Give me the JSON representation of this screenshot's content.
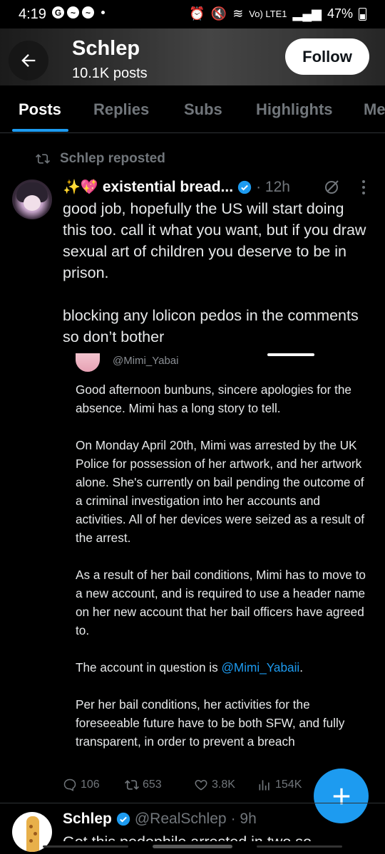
{
  "status_bar": {
    "time": "4:19",
    "left_icons": [
      "google-icon",
      "messenger-icon",
      "messenger-icon",
      "dot"
    ],
    "network": "Vo) LTE1",
    "battery": "47%"
  },
  "header": {
    "name": "Schlep",
    "posts": "10.1K posts",
    "follow_label": "Follow"
  },
  "tabs": [
    {
      "label": "Posts",
      "active": true
    },
    {
      "label": "Replies"
    },
    {
      "label": "Subs"
    },
    {
      "label": "Highlights"
    },
    {
      "label": "Me"
    }
  ],
  "tweet1": {
    "repost_label": "Schlep reposted",
    "emoji_prefix": "✨💖",
    "author": "existential bread...",
    "time": "· 12h",
    "text": "good job, hopefully the US will start doing this too. call it what you want, but if you draw sexual art of children you deserve to be in prison.\n\nblocking any lolicon pedos in the comments so don’t bother",
    "embed": {
      "handle": "@Mimi_Yabai",
      "para1": "Good afternoon bunbuns, sincere apologies for the absence. Mimi has a long story to tell.",
      "para2": "On Monday April 20th, Mimi was arrested by the UK Police for possession of her artwork, and her artwork alone. She's currently on bail pending the outcome of a criminal investigation into her accounts and activities. All of her devices were seized as a result of the arrest.",
      "para3": "As a result of her bail conditions, Mimi has to move to a new account, and is required to use a header name on her new account that her bail officers have agreed to.",
      "para4_prefix": "The account in question is ",
      "para4_link": "@Mimi_Yabaii",
      "para4_suffix": ".",
      "para5": "Per her bail conditions, her activities for the foreseeable future have to be both SFW, and fully transparent, in order to prevent a breach"
    },
    "actions": {
      "replies": "106",
      "reposts": "653",
      "likes": "3.8K",
      "views": "154K"
    }
  },
  "tweet2": {
    "author": "Schlep",
    "handle": "@RealSchlep",
    "time": "· 9h",
    "text": "Got this pedophile arrested in two so"
  },
  "colors": {
    "accent": "#1d9bf0",
    "background": "#000000",
    "muted": "#71767b"
  }
}
